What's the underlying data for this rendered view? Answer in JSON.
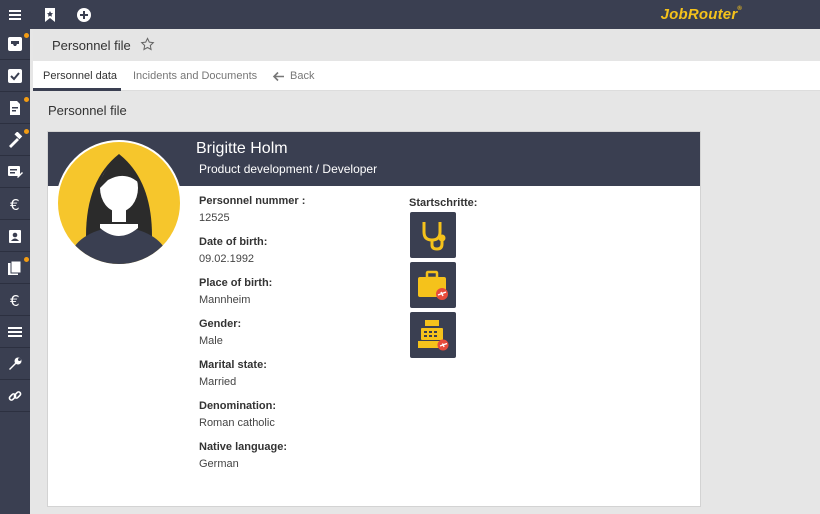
{
  "app": {
    "brand": "JobRouter",
    "brand_mark": "®"
  },
  "topbar": {
    "icons": [
      "menu-icon",
      "bookmark-icon",
      "add-icon"
    ]
  },
  "sidebar": {
    "items": [
      {
        "icon": "inbox-icon",
        "badge": true
      },
      {
        "icon": "checkbox-icon",
        "badge": false
      },
      {
        "icon": "document-edit-icon",
        "badge": true
      },
      {
        "icon": "hammer-icon",
        "badge": true
      },
      {
        "icon": "list-edit-icon",
        "badge": false
      },
      {
        "icon": "euro-icon",
        "badge": false
      },
      {
        "icon": "contact-icon",
        "badge": false
      },
      {
        "icon": "documents-icon",
        "badge": true
      },
      {
        "icon": "euro-icon",
        "badge": false
      },
      {
        "icon": "list-icon",
        "badge": false
      },
      {
        "icon": "wrench-icon",
        "badge": false
      },
      {
        "icon": "link-icon",
        "badge": false
      }
    ]
  },
  "header": {
    "title": "Personnel file"
  },
  "tabs": [
    {
      "label": "Personnel data",
      "active": true
    },
    {
      "label": "Incidents and Documents",
      "active": false
    },
    {
      "label": "Back",
      "active": false
    }
  ],
  "main": {
    "section_title": "Personnel file",
    "person": {
      "name": "Brigitte Holm",
      "department": "Product development / Developer"
    },
    "fields": [
      {
        "label": "Personnel nummer :",
        "value": "12525"
      },
      {
        "label": "Date of birth:",
        "value": "09.02.1992"
      },
      {
        "label": "Place of birth:",
        "value": "Mannheim"
      },
      {
        "label": "Gender:",
        "value": "Male"
      },
      {
        "label": "Marital state:",
        "value": "Married"
      },
      {
        "label": "Denomination:",
        "value": "Roman catholic"
      },
      {
        "label": "Native language:",
        "value": "German"
      }
    ],
    "start_steps": {
      "label": "Startschritte:",
      "items": [
        "stethoscope-icon",
        "suitcase-flight-icon",
        "cash-register-icon"
      ]
    }
  },
  "colors": {
    "dark": "#3a3f51",
    "accent": "#f5c21b",
    "badge": "#f39c12"
  }
}
